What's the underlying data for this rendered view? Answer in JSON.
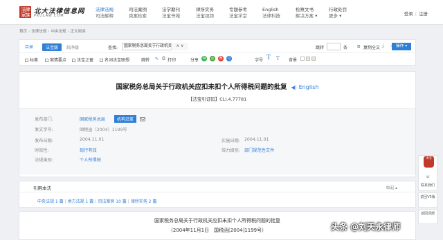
{
  "logo": {
    "seal": "法律\n家族",
    "name": "北大法律信息网",
    "domain": "PKULAW.COM"
  },
  "nav": [
    {
      "r1": "法律法规",
      "r2": "司法解释",
      "active": true
    },
    {
      "r1": "司法案例",
      "r2": "类案检索"
    },
    {
      "r1": "法学期刊",
      "r2": "法宝书城"
    },
    {
      "r1": "律所实务",
      "r2": "法宝视频"
    },
    {
      "r1": "专题参考",
      "r2": "法宝学堂"
    },
    {
      "r1": "English",
      "r2": "法律科技"
    },
    {
      "r1": "检察文书",
      "r2": "解决方案 ▾"
    },
    {
      "r1": "行政处罚",
      "r2": "更多 ▾"
    }
  ],
  "auth": {
    "login": "登录",
    "register": "注册"
  },
  "breadcrumb": [
    "首页",
    "法律法规",
    "中央法规",
    "正文阅读"
  ],
  "toolbar": {
    "catalog": "目录",
    "tab_active": "法宝版",
    "tab_inactive": "纯净版",
    "find_label": "查找:",
    "find_value": "国家税务总局关于行政机关应扣未扣个人所得税问题的批复",
    "find_arrows": "∧ ∨",
    "jump_label": "跳转",
    "jump_unit": "条",
    "copy_all": "复制全文",
    "operate": "操作",
    "checks": [
      "标黄",
      "案情要点",
      "法宝之窗",
      "名词法宝联想"
    ],
    "jump_link": "跳转",
    "print": "打印",
    "share": "分享",
    "font_label": "字号",
    "font_big": "T",
    "font_small": "T",
    "bg_label": "背景"
  },
  "doc": {
    "title": "国家税务总局关于行政机关应扣未扣个人所得税问题的批复",
    "speaker": "◀)",
    "english": "English",
    "cite": "【法宝引证码】CLI.4.77781"
  },
  "meta": {
    "issuer_label": "发布部门:",
    "issuer_value": "国家税务总局",
    "issuer_tag": "机构沿革",
    "docno_label": "发文字号:",
    "docno_value": "国税函〔2004〕1199号",
    "pubdate_label": "发布日期:",
    "pubdate_value": "2004.11.01",
    "effdate_label": "实施日期:",
    "effdate_value": "2004.11.01",
    "validity_label": "时效性:",
    "validity_value": "现行有效",
    "level_label": "效力级别:",
    "level_value": "部门规范性文件",
    "category_label": "法规类别:",
    "category_value": "个人所得税"
  },
  "cite_section": {
    "title": "引用本法",
    "fold": "收起 ▴",
    "links": [
      "中央法规 1 篇",
      "地方法规 1 篇",
      "司法案例 10 篇",
      "律所实务 2 篇"
    ]
  },
  "body": {
    "title": "国家税务总局关于行政机关应扣未扣个人所得税问题的批复",
    "subtitle": "（2004年11月1日　国税函[2004]1199号）"
  },
  "sidebar": {
    "robot": "法宝",
    "contact": "联系我们",
    "back_old": "返回V5版",
    "back_top": "返回顶部"
  },
  "watermark": "头条 @刘天永律师",
  "colors": {
    "accent": "#2f7fd6",
    "brand_red": "#c0392b"
  }
}
